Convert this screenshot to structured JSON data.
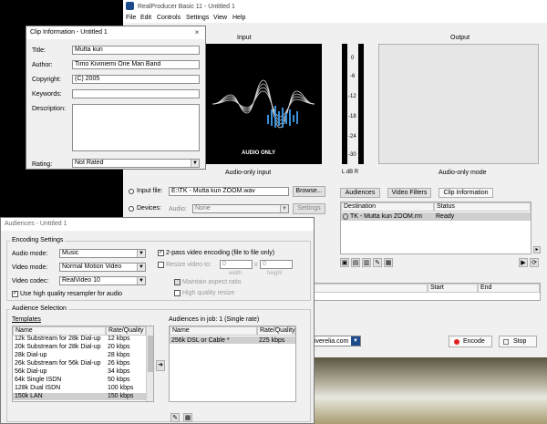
{
  "main_window": {
    "title": "RealProducer Basic 11 - Untitled 1",
    "menu": [
      "File",
      "Edit",
      "Controls",
      "Settings",
      "View",
      "Help"
    ],
    "input_label": "Input",
    "output_label": "Output",
    "audio_only_text": "AUDIO ONLY",
    "audio_only_input": "Audio-only input",
    "audio_only_mode": "Audio-only mode",
    "meter_ticks": [
      "0",
      "-6",
      "-12",
      "-18",
      "-24",
      "-30"
    ],
    "meter_lr": "L  dB  R",
    "input_file_label": "Input file:",
    "input_file_value": "E:\\TK - Mutta kun ZOOM.wav",
    "browse_label": "Browse...",
    "devices_label": "Devices:",
    "audio_label": "Audio:",
    "audio_value": "None",
    "settings_label": "Settings",
    "tab_audiences": "Audiences",
    "tab_video_filters": "Video Filters",
    "tab_clip_information": "Clip Information",
    "dest_header": "Destination",
    "status_header": "Status",
    "dest_row": "TK - Mutta kun ZOOM.rm",
    "status_row": "Ready",
    "start_header": "Start",
    "end_header": "End",
    "url_fragment": "tiverelia.com",
    "encode_label": "Encode",
    "stop_label": "Stop"
  },
  "clip_info": {
    "title": "Clip Information - Untitled 1",
    "title_label": "Title:",
    "title_value": "Mutta kun",
    "author_label": "Author:",
    "author_value": "Timo Kiviniemi One Man Band",
    "copyright_label": "Copyright:",
    "copyright_value": "(C) 2005",
    "keywords_label": "Keywords:",
    "keywords_value": "",
    "description_label": "Description:",
    "description_value": "",
    "rating_label": "Rating:",
    "rating_value": "Not Rated"
  },
  "audiences": {
    "title": "Audiences - Untitled 1",
    "encoding_settings": "Encoding Settings",
    "audio_mode_label": "Audio mode:",
    "audio_mode_value": "Music",
    "video_mode_label": "Video mode:",
    "video_mode_value": "Normal Motion Video",
    "video_codec_label": "Video codec:",
    "video_codec_value": "RealVideo 10",
    "resampler_label": "Use high quality resampler for audio",
    "two_pass_label": "2-pass video encoding (file to file only)",
    "resize_label": "Resize video to:",
    "resize_w": "0",
    "resize_h": "0",
    "width_label": "width",
    "height_label": "height",
    "maintain_label": "Maintain aspect ratio",
    "highquality_resize_label": "High quality resize",
    "audience_selection": "Audience Selection",
    "templates_label": "Templates",
    "template_headers": [
      "Name",
      "Rate/Quality"
    ],
    "templates": [
      {
        "name": "12k Substream for 28k Dial-up",
        "rate": "12 kbps"
      },
      {
        "name": "20k Substream for 28k Dial-up",
        "rate": "20 kbps"
      },
      {
        "name": "28k Dial-up",
        "rate": "28 kbps"
      },
      {
        "name": "26k Substream for 56k Dial-up",
        "rate": "26 kbps"
      },
      {
        "name": "56k Dial-up",
        "rate": "34 kbps"
      },
      {
        "name": "64k Single ISDN",
        "rate": "50 kbps"
      },
      {
        "name": "128k Dual ISDN",
        "rate": "100 kbps"
      },
      {
        "name": "150k LAN",
        "rate": "150 kbps"
      }
    ],
    "audiences_in_job_label": "Audiences in job: 1 (Single rate)",
    "job_headers": [
      "Name",
      "Rate/Quality"
    ],
    "job_rows": [
      {
        "name": "256k DSL or Cable *",
        "rate": "225 kbps"
      }
    ],
    "add_arrow": "➜"
  },
  "colors": {
    "progress_red": "#e02020",
    "blue_accent": "#1c4a8c",
    "selected_row": "#cfcfcf"
  }
}
